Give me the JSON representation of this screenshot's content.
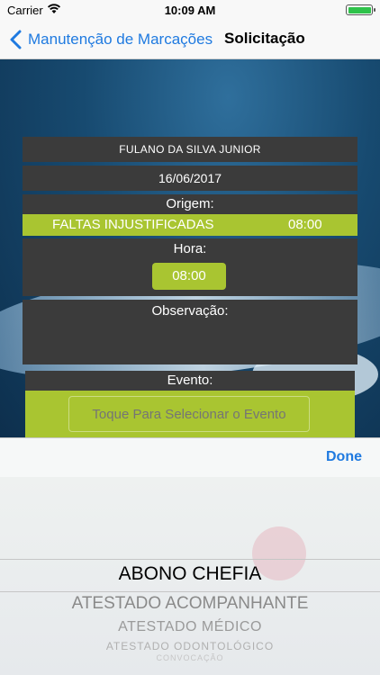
{
  "status_bar": {
    "carrier": "Carrier",
    "time": "10:09 AM"
  },
  "nav": {
    "back_label": "Manutenção de Marcações",
    "title": "Solicitação"
  },
  "form": {
    "employee_name": "FULANO DA SILVA JUNIOR",
    "date": "16/06/2017",
    "origin": {
      "label": "Origem:",
      "event": "FALTAS INJUSTIFICADAS",
      "time": "08:00"
    },
    "hora": {
      "label": "Hora:",
      "value": "08:00"
    },
    "observacao": {
      "label": "Observação:"
    },
    "evento": {
      "label": "Evento:",
      "placeholder": "Toque Para Selecionar o Evento"
    }
  },
  "picker": {
    "done_label": "Done",
    "items": [
      "ABONO CHEFIA",
      "ATESTADO ACOMPANHANTE",
      "ATESTADO MÉDICO",
      "ATESTADO ODONTOLÓGICO",
      "CONVOCAÇÃO"
    ],
    "selected": "ABONO CHEFIA"
  },
  "colors": {
    "accent_green": "#a9c531",
    "card_dark": "#3b3b3b",
    "ios_blue": "#1f7ae0"
  }
}
